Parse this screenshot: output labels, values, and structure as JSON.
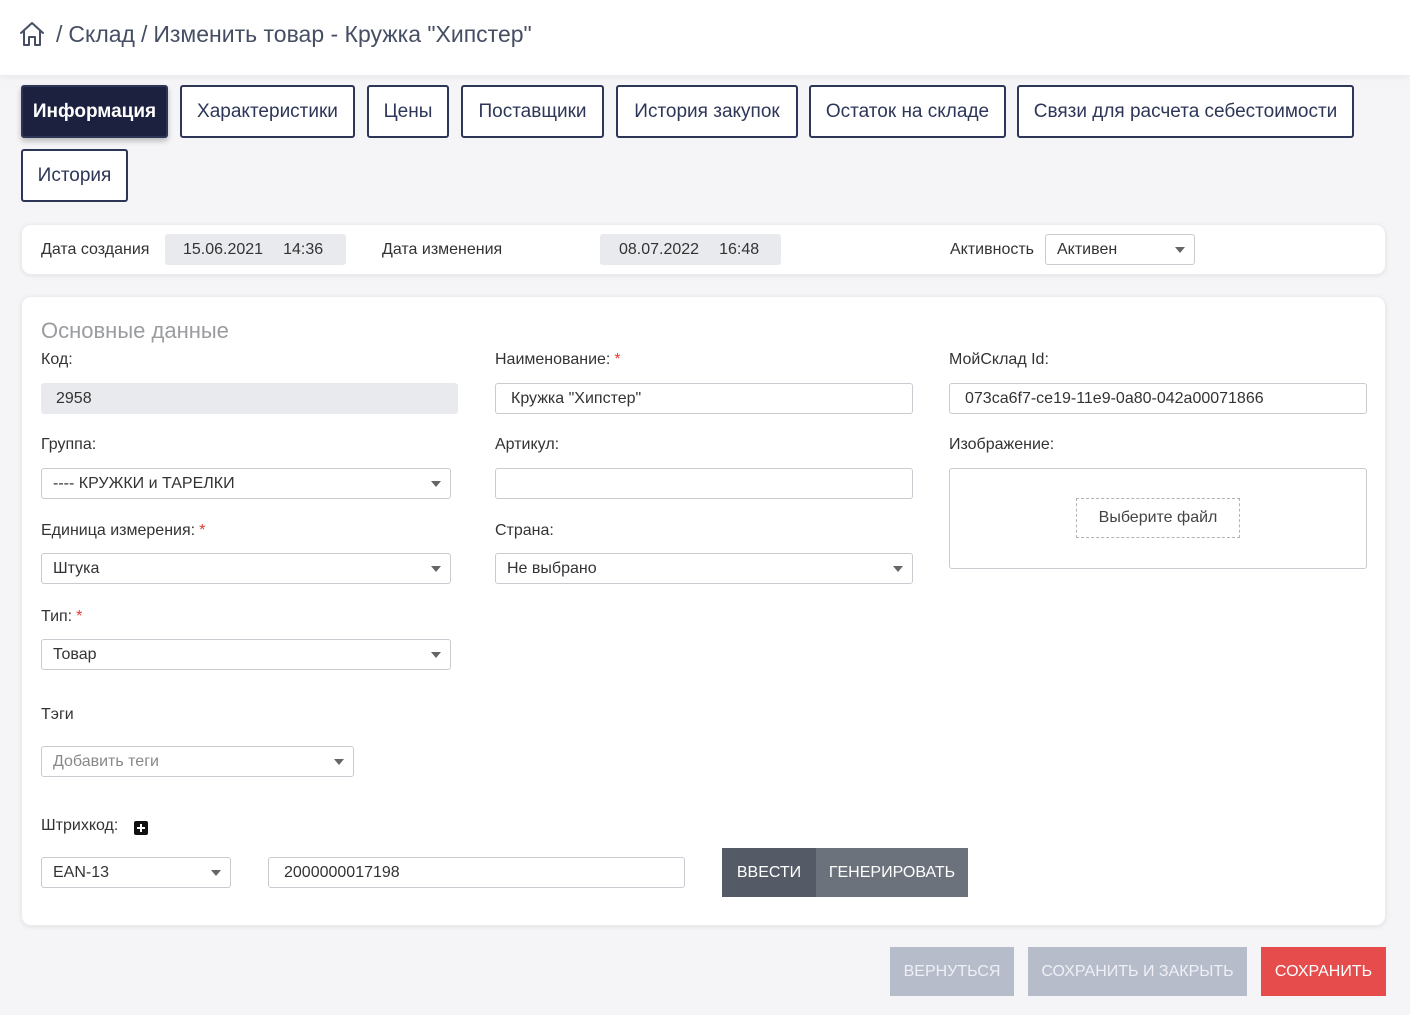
{
  "breadcrumb": {
    "items": [
      "Склад",
      "Изменить товар - Кружка \"Хипстер\""
    ]
  },
  "tabs": [
    {
      "label": "Информация",
      "active": true
    },
    {
      "label": "Характеристики",
      "active": false
    },
    {
      "label": "Цены",
      "active": false
    },
    {
      "label": "Поставщики",
      "active": false
    },
    {
      "label": "История закупок",
      "active": false
    },
    {
      "label": "Остаток на складе",
      "active": false
    },
    {
      "label": "Связи для расчета себестоимости",
      "active": false
    },
    {
      "label": "История",
      "active": false
    }
  ],
  "meta": {
    "created_label": "Дата создания",
    "created_date": "15.06.2021",
    "created_time": "14:36",
    "modified_label": "Дата изменения",
    "modified_date": "08.07.2022",
    "modified_time": "16:48",
    "activity_label": "Активность",
    "activity_value": "Активен"
  },
  "main": {
    "title": "Основные данные",
    "code": {
      "label": "Код:",
      "value": "2958"
    },
    "name": {
      "label": "Наименование:",
      "value": "Кружка \"Хипстер\"",
      "required": "*"
    },
    "moysklad": {
      "label": "МойСклад Id:",
      "value": "073ca6f7-ce19-11e9-0a80-042a00071866"
    },
    "group": {
      "label": "Группа:",
      "value": "---- КРУЖКИ и ТАРЕЛКИ"
    },
    "article": {
      "label": "Артикул:",
      "value": ""
    },
    "image": {
      "label": "Изображение:",
      "button": "Выберите файл"
    },
    "unit": {
      "label": "Единица измерения:",
      "value": "Штука",
      "required": "*"
    },
    "country": {
      "label": "Страна:",
      "value": "Не выбрано"
    },
    "type": {
      "label": "Тип:",
      "value": "Товар",
      "required": "*"
    },
    "tags": {
      "label": "Тэги",
      "placeholder": "Добавить теги"
    },
    "barcode": {
      "label": "Штрихкод:",
      "type": "EAN-13",
      "value": "2000000017198",
      "enter_label": "ВВЕСТИ",
      "generate_label": "ГЕНЕРИРОВАТЬ"
    }
  },
  "footer": {
    "back_label": "ВЕРНУТЬСЯ",
    "save_close_label": "СОХРАНИТЬ И ЗАКРЫТЬ",
    "save_label": "СОХРАНИТЬ"
  },
  "colors": {
    "accent_dark": "#1c2140",
    "danger": "#e74c4c",
    "disabled": "#b7bccb"
  }
}
